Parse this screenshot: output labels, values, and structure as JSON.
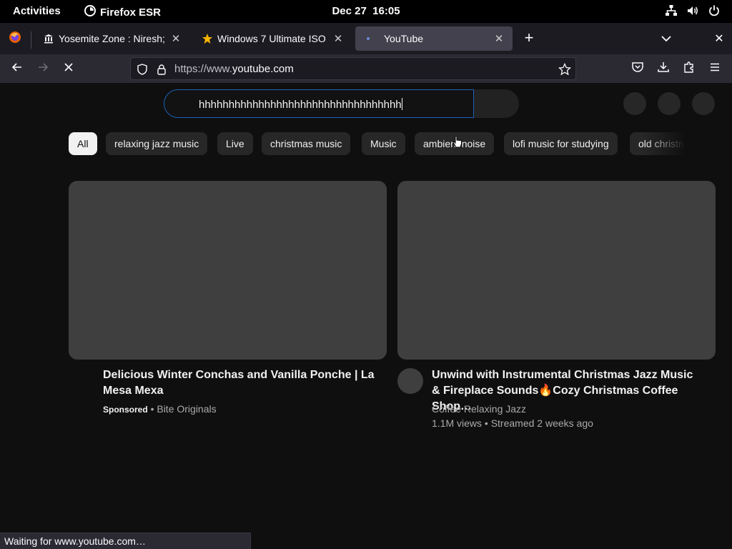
{
  "topbar": {
    "activities": "Activities",
    "app_name": "Firefox ESR",
    "date": "Dec 27",
    "time": "16:05"
  },
  "tabs": [
    {
      "title": "Yosemite Zone : Niresh; A",
      "icon": "institution-icon",
      "active": false
    },
    {
      "title": "Windows 7 Ultimate ISO",
      "icon": "star-icon",
      "active": false
    },
    {
      "title": "YouTube",
      "icon": "loading-dot-icon",
      "active": true
    }
  ],
  "urlbar": {
    "scheme": "https://www.",
    "host": "youtube.com"
  },
  "search": {
    "value": "hhhhhhhhhhhhhhhhhhhhhhhhhhhhhhhhhh"
  },
  "chips": [
    "All",
    "relaxing jazz music",
    "Live",
    "christmas music",
    "Music",
    "ambient noise",
    "lofi music for studying",
    "old christmas"
  ],
  "videos": [
    {
      "title": "Delicious Winter Conchas and Vanilla Ponche | La Mesa Mexa",
      "sponsored_label": "Sponsored",
      "separator": "•",
      "channel": "Bite Originals"
    },
    {
      "title": "Unwind with Instrumental Christmas Jazz Music & Fireplace Sounds🔥Cozy Christmas Coffee Shop…",
      "channel": "Coffee Relaxing Jazz",
      "stats": "1.1M views • Streamed 2 weeks ago"
    }
  ],
  "status": {
    "text": "Waiting for www.youtube.com…"
  },
  "colors": {
    "background": "#0f0f0f",
    "search_focus": "#1c62b9",
    "chip": "#272727",
    "chip_selected": "#f1f1f1",
    "thumbnail_placeholder": "#3f3f3f"
  }
}
